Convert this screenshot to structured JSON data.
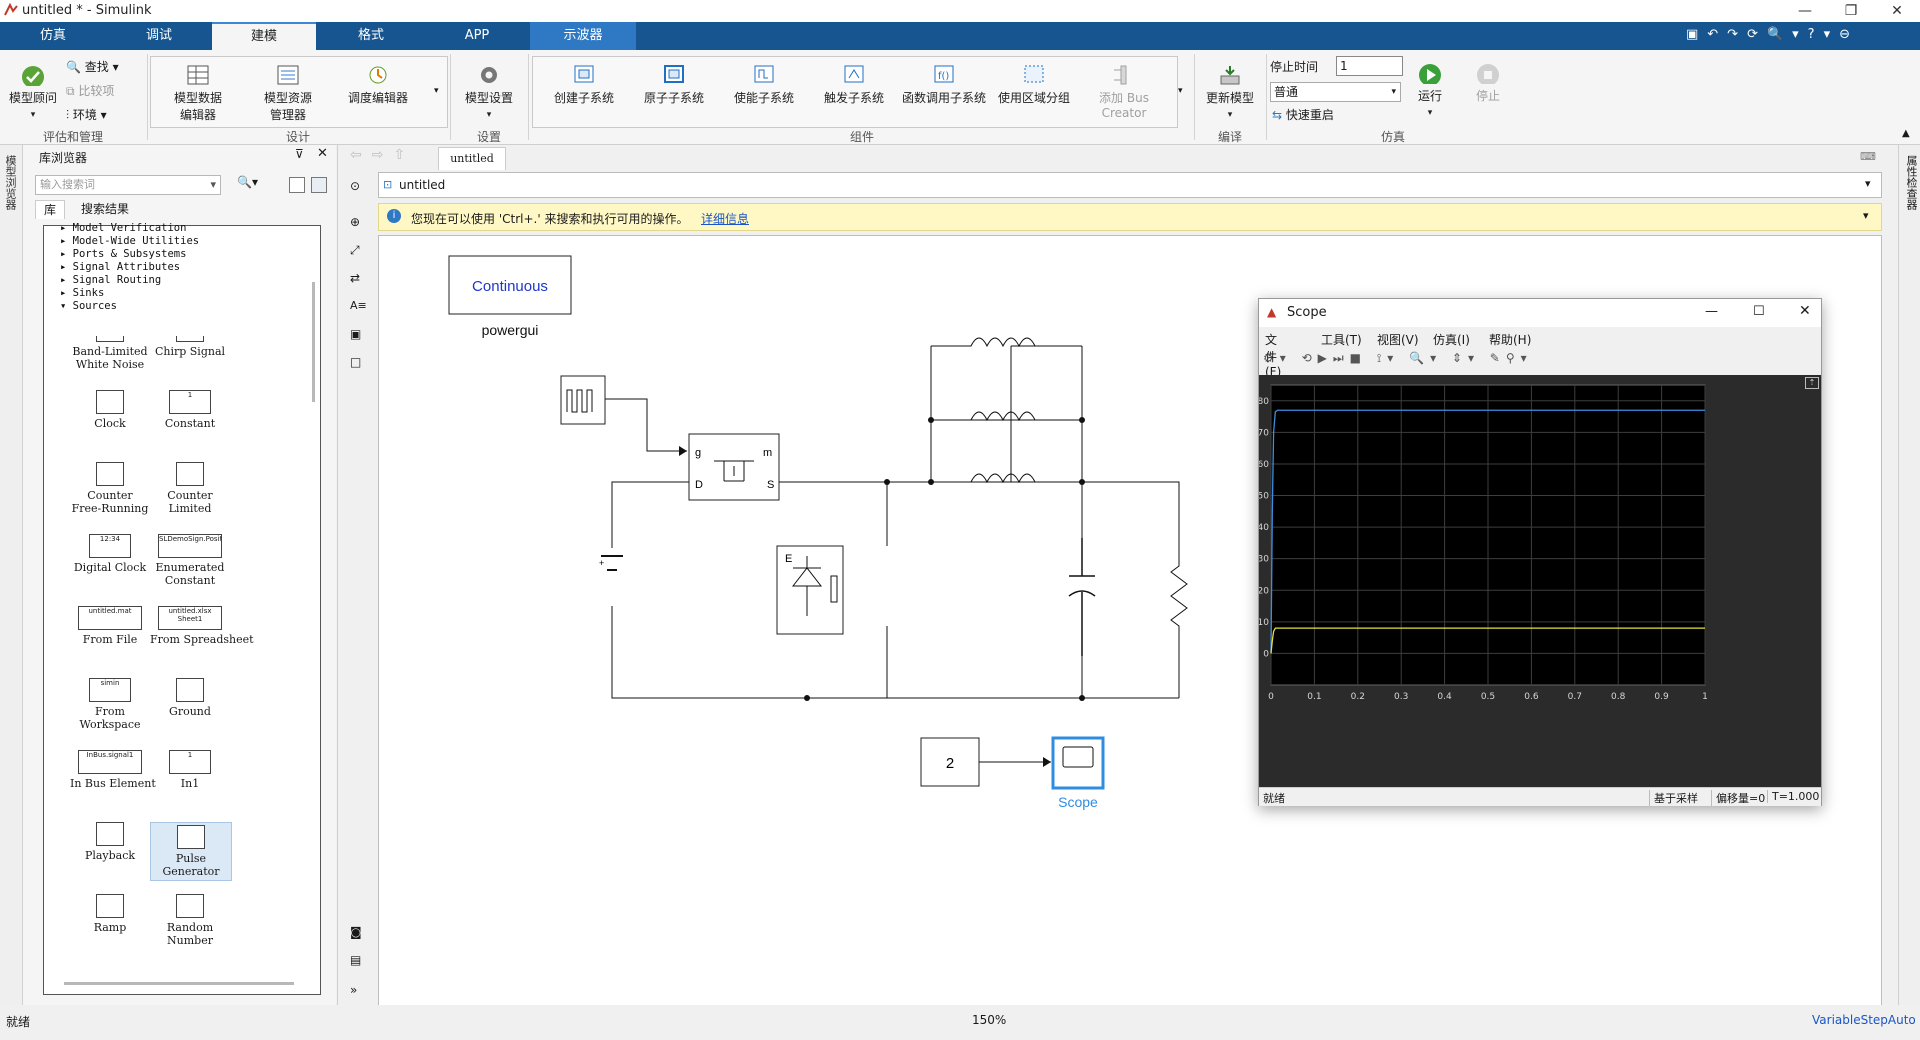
{
  "window": {
    "title": "untitled * - Simulink"
  },
  "menu_tabs": [
    "仿真",
    "调试",
    "建模",
    "格式",
    "APP",
    "示波器"
  ],
  "ribbon": {
    "eval": {
      "advisor": "模型顾问",
      "find": "查找",
      "compare": "比较项",
      "env": "环境",
      "group": "评估和管理"
    },
    "design": {
      "data_editor": [
        "模型数据",
        "编辑器"
      ],
      "explorer": [
        "模型资源",
        "管理器"
      ],
      "schedule": "调度编辑器",
      "group": "设计"
    },
    "setup": {
      "settings": "模型设置",
      "group": "设置"
    },
    "components": {
      "items": [
        "创建子系统",
        "原子子系统",
        "使能子系统",
        "触发子系统",
        "函数调用子系统",
        "使用区域分组",
        "添加 Bus Creator"
      ],
      "group": "组件"
    },
    "compile": {
      "update": "更新模型",
      "group": "编译"
    },
    "simulation": {
      "stop_time_label": "停止时间",
      "stop_time_value": "1",
      "mode": "普通",
      "fast_restart": "快速重启",
      "run": "运行",
      "stop": "停止",
      "group": "仿真"
    }
  },
  "library": {
    "title": "库浏览器",
    "search_placeholder": "输入搜索词",
    "tab_lib": "库",
    "tab_results": "搜索结果",
    "tree": [
      "Model Verification",
      "Model-Wide Utilities",
      "Ports & Subsystems",
      "Signal Attributes",
      "Signal Routing",
      "Sinks",
      "Sources"
    ],
    "blocks": [
      {
        "name": "Band-Limited\nWhite Noise",
        "icon": "noise-icon"
      },
      {
        "name": "Chirp Signal",
        "icon": "chirp-icon"
      },
      {
        "name": "Clock",
        "icon": "clock-icon"
      },
      {
        "name": "Constant",
        "icon": "constant-icon",
        "text": "1"
      },
      {
        "name": "Counter\nFree-Running",
        "icon": "counter-icon"
      },
      {
        "name": "Counter\nLimited",
        "icon": "counter-limited-icon"
      },
      {
        "name": "Digital Clock",
        "icon": "digital-clock-icon",
        "text": "12:34"
      },
      {
        "name": "Enumerated\nConstant",
        "icon": "enum-icon",
        "text": "SLDemoSign.Positive"
      },
      {
        "name": "From File",
        "icon": "from-file-icon",
        "text": "untitled.mat"
      },
      {
        "name": "From Spreadsheet",
        "icon": "spreadsheet-icon",
        "text": "untitled.xlsx\nSheet1"
      },
      {
        "name": "From\nWorkspace",
        "icon": "workspace-icon",
        "text": "simin"
      },
      {
        "name": "Ground",
        "icon": "ground-icon"
      },
      {
        "name": "In Bus Element",
        "icon": "bus-element-icon",
        "text": "InBus.signal1"
      },
      {
        "name": "In1",
        "icon": "in1-icon",
        "text": "1"
      },
      {
        "name": "Playback",
        "icon": "playback-icon"
      },
      {
        "name": "Pulse\nGenerator",
        "icon": "pulse-icon"
      },
      {
        "name": "Ramp",
        "icon": "ramp-icon"
      },
      {
        "name": "Random\nNumber",
        "icon": "random-icon"
      }
    ]
  },
  "editor": {
    "tab": "untitled",
    "path": "untitled",
    "info": "您现在可以使用 'Ctrl+.' 来搜索和执行可用的操作。",
    "info_link": "详细信息"
  },
  "diagram": {
    "powergui_text": "Continuous",
    "powergui_label": "powergui",
    "constant_value": "2",
    "scope_label": "Scope",
    "mosfet_ports": [
      "g",
      "m",
      "D",
      "S"
    ],
    "diode_label": "E"
  },
  "scope_window": {
    "title": "Scope",
    "menus": [
      "文件(F)",
      "工具(T)",
      "视图(V)",
      "仿真(I)",
      "帮助(H)"
    ],
    "status": "就绪",
    "status_right": [
      "基于采样",
      "偏移量=0",
      "T=1.000"
    ]
  },
  "chart_data": {
    "type": "line",
    "title": "",
    "xlabel": "",
    "ylabel": "",
    "xlim": [
      0,
      1
    ],
    "ylim": [
      -10,
      85
    ],
    "x_ticks": [
      "0",
      "0.1",
      "0.2",
      "0.3",
      "0.4",
      "0.5",
      "0.6",
      "0.7",
      "0.8",
      "0.9",
      "1"
    ],
    "y_ticks": [
      "0",
      "10",
      "20",
      "30",
      "40",
      "50",
      "60",
      "70",
      "80"
    ],
    "grid": true,
    "series": [
      {
        "color": "#3f8fe0",
        "x": [
          0,
          0.003,
          0.006,
          0.01,
          0.015,
          1.0
        ],
        "y": [
          0,
          45,
          70,
          76.5,
          77,
          77
        ]
      },
      {
        "color": "#e6e23a",
        "x": [
          0,
          0.003,
          0.006,
          0.01,
          0.015,
          1.0
        ],
        "y": [
          0,
          4,
          7,
          8,
          8,
          8
        ]
      }
    ]
  },
  "statusbar": {
    "left": "就绪",
    "zoom": "150%",
    "solver": "VariableStepAuto"
  }
}
